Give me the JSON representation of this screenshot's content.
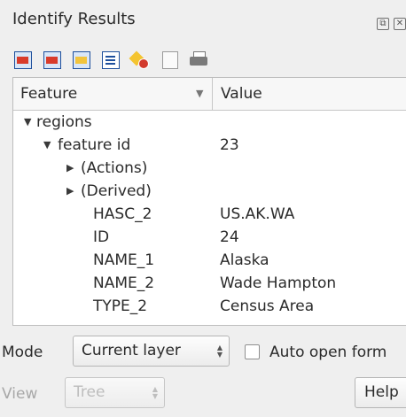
{
  "panel": {
    "title": "Identify Results",
    "float_glyph": "⧉",
    "close_glyph": "✕"
  },
  "toolbar": {
    "icons": [
      "expand-tree-icon",
      "collapse-tree-icon",
      "expand-new-results-icon",
      "open-form-icon",
      "clear-results-icon",
      "copy-feature-icon",
      "print-icon"
    ]
  },
  "tree": {
    "header": {
      "feature": "Feature",
      "value": "Value",
      "sort_glyph": "▼"
    },
    "rows": [
      {
        "depth": 0,
        "expander": "▼",
        "feature": "regions",
        "value": ""
      },
      {
        "depth": 1,
        "expander": "▼",
        "feature": "feature id",
        "value": "23"
      },
      {
        "depth": 2,
        "expander": "▶",
        "feature": "(Actions)",
        "value": ""
      },
      {
        "depth": 2,
        "expander": "▶",
        "feature": "(Derived)",
        "value": ""
      },
      {
        "depth": 2,
        "expander": "",
        "feature": "HASC_2",
        "value": "US.AK.WA"
      },
      {
        "depth": 2,
        "expander": "",
        "feature": "ID",
        "value": "24"
      },
      {
        "depth": 2,
        "expander": "",
        "feature": "NAME_1",
        "value": "Alaska"
      },
      {
        "depth": 2,
        "expander": "",
        "feature": "NAME_2",
        "value": "Wade Hampton"
      },
      {
        "depth": 2,
        "expander": "",
        "feature": "TYPE_2",
        "value": "Census Area"
      }
    ]
  },
  "footer": {
    "mode_label": "Mode",
    "mode_value": "Current layer",
    "auto_open_label": "Auto open form",
    "auto_open_checked": false,
    "view_label": "View",
    "view_value": "Tree",
    "help_label": "Help"
  }
}
